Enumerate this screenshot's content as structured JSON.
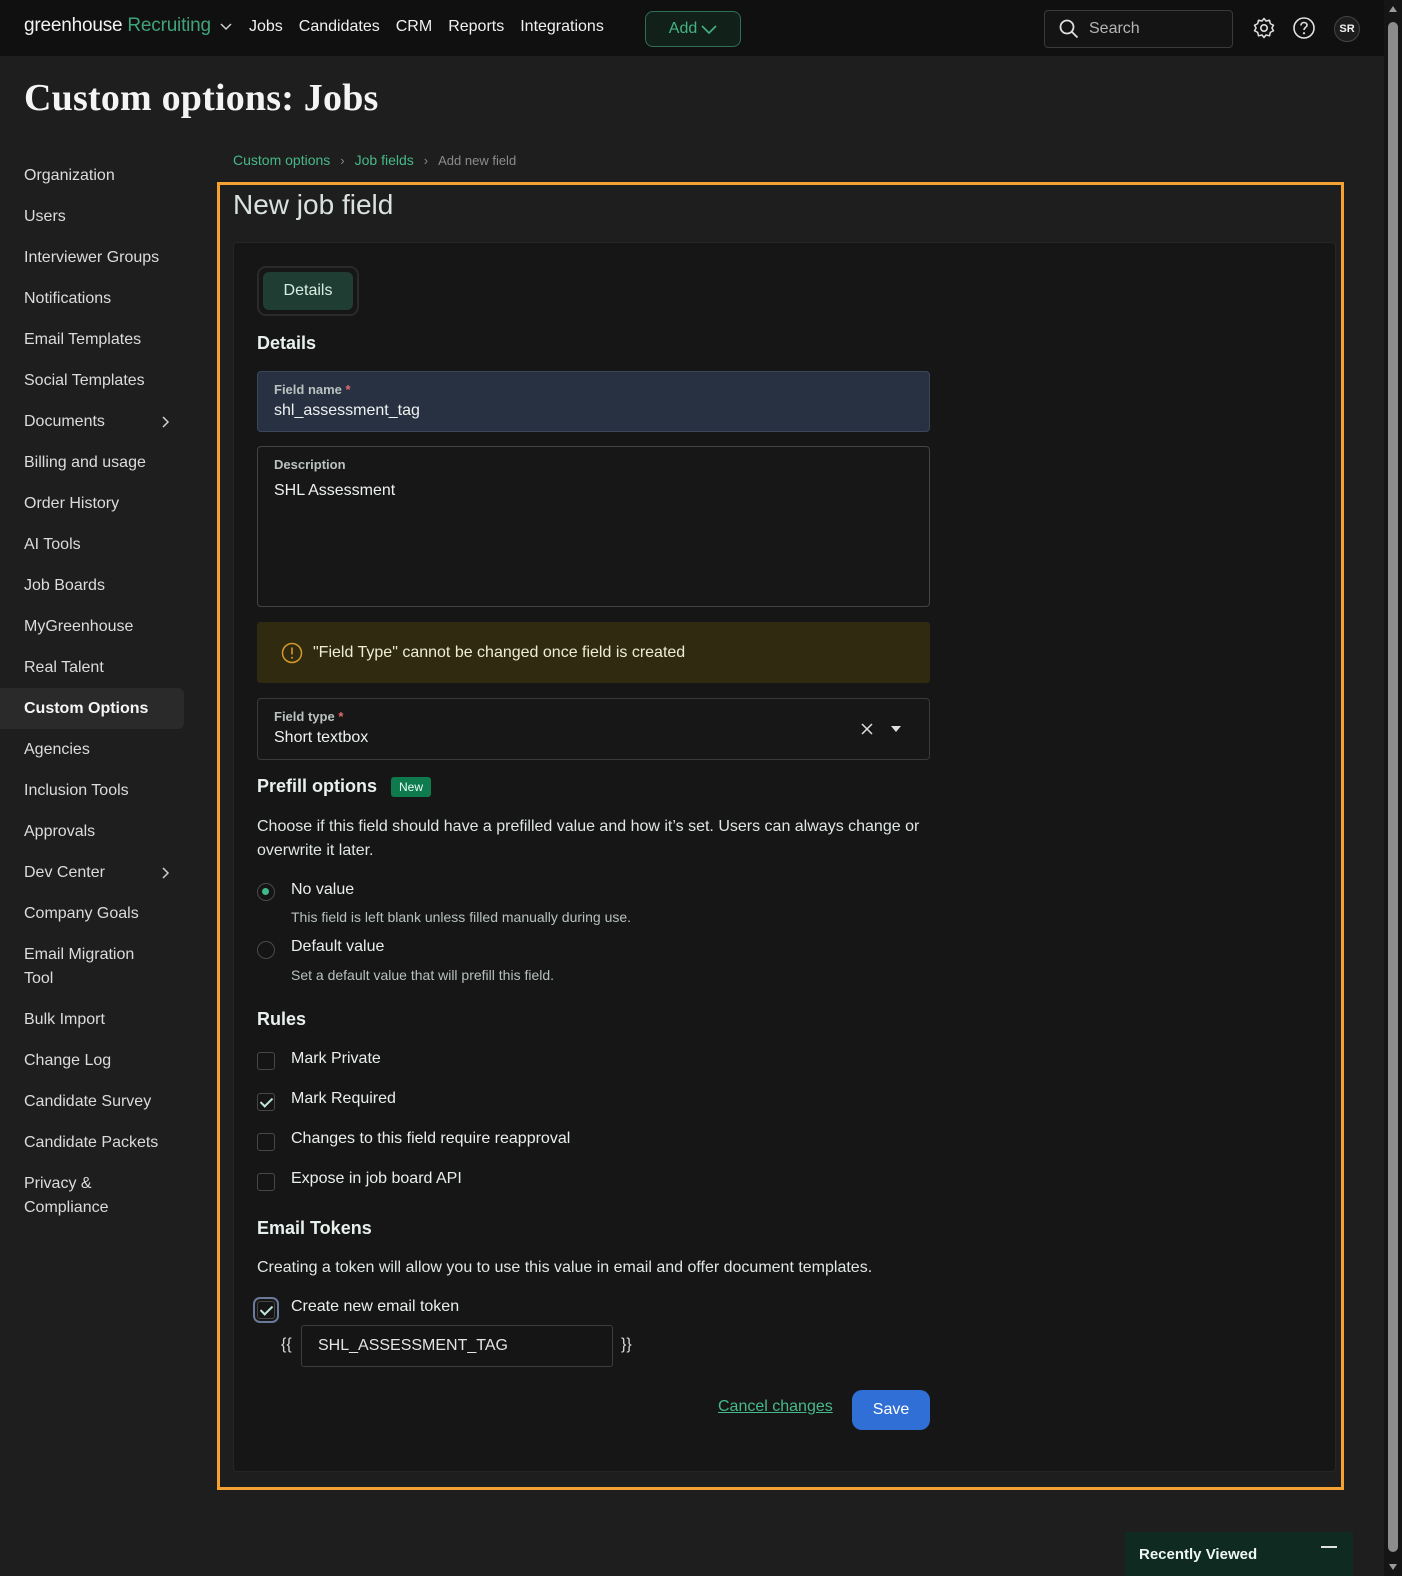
{
  "topnav": {
    "logo_main": "greenhouse",
    "logo_sub": "Recruiting",
    "links": [
      "Jobs",
      "Candidates",
      "CRM",
      "Reports",
      "Integrations"
    ],
    "add_label": "Add",
    "search_placeholder": "Search",
    "avatar_initials": "SR"
  },
  "page_title": "Custom options: Jobs",
  "sidebar": {
    "items": [
      {
        "label": "Organization",
        "has_chevron": false,
        "active": false
      },
      {
        "label": "Users",
        "has_chevron": false,
        "active": false
      },
      {
        "label": "Interviewer Groups",
        "has_chevron": false,
        "active": false
      },
      {
        "label": "Notifications",
        "has_chevron": false,
        "active": false
      },
      {
        "label": "Email Templates",
        "has_chevron": false,
        "active": false
      },
      {
        "label": "Social Templates",
        "has_chevron": false,
        "active": false
      },
      {
        "label": "Documents",
        "has_chevron": true,
        "active": false
      },
      {
        "label": "Billing and usage",
        "has_chevron": false,
        "active": false
      },
      {
        "label": "Order History",
        "has_chevron": false,
        "active": false
      },
      {
        "label": "AI Tools",
        "has_chevron": false,
        "active": false
      },
      {
        "label": "Job Boards",
        "has_chevron": false,
        "active": false
      },
      {
        "label": "MyGreenhouse",
        "has_chevron": false,
        "active": false
      },
      {
        "label": "Real Talent",
        "has_chevron": false,
        "active": false
      },
      {
        "label": "Custom Options",
        "has_chevron": false,
        "active": true
      },
      {
        "label": "Agencies",
        "has_chevron": false,
        "active": false
      },
      {
        "label": "Inclusion Tools",
        "has_chevron": false,
        "active": false
      },
      {
        "label": "Approvals",
        "has_chevron": false,
        "active": false
      },
      {
        "label": "Dev Center",
        "has_chevron": true,
        "active": false
      },
      {
        "label": "Company Goals",
        "has_chevron": false,
        "active": false
      },
      {
        "label": "Email Migration Tool",
        "has_chevron": false,
        "active": false
      },
      {
        "label": "Bulk Import",
        "has_chevron": false,
        "active": false
      },
      {
        "label": "Change Log",
        "has_chevron": false,
        "active": false
      },
      {
        "label": "Candidate Survey",
        "has_chevron": false,
        "active": false
      },
      {
        "label": "Candidate Packets",
        "has_chevron": false,
        "active": false
      },
      {
        "label": "Privacy & Compliance",
        "has_chevron": false,
        "active": false
      }
    ]
  },
  "breadcrumb": {
    "items": [
      "Custom options",
      "Job fields"
    ],
    "current": "Add new field"
  },
  "form": {
    "title": "New job field",
    "tab_label": "Details",
    "details_heading": "Details",
    "field_name": {
      "label": "Field name",
      "required_mark": "*",
      "value": "shl_assessment_tag"
    },
    "description": {
      "label": "Description",
      "value": "SHL Assessment"
    },
    "alert_text": "\"Field Type\" cannot be changed once field is created",
    "field_type": {
      "label": "Field type",
      "required_mark": "*",
      "value": "Short textbox"
    },
    "prefill": {
      "heading": "Prefill options",
      "badge": "New",
      "description": "Choose if this field should have a prefilled value and how it’s set. Users can always change or overwrite it later.",
      "options": [
        {
          "label": "No value",
          "help": "This field is left blank unless filled manually during use.",
          "selected": true
        },
        {
          "label": "Default value",
          "help": "Set a default value that will prefill this field.",
          "selected": false
        }
      ]
    },
    "rules": {
      "heading": "Rules",
      "items": [
        {
          "label": "Mark Private",
          "checked": false
        },
        {
          "label": "Mark Required",
          "checked": true
        },
        {
          "label": "Changes to this field require reapproval",
          "checked": false
        },
        {
          "label": "Expose in job board API",
          "checked": false
        }
      ]
    },
    "email_tokens": {
      "heading": "Email Tokens",
      "description": "Creating a token will allow you to use this value in email and offer document templates.",
      "checkbox_label": "Create new email token",
      "checked": true,
      "open_brace": "{{",
      "close_brace": "}}",
      "token_value": "SHL_ASSESSMENT_TAG"
    },
    "cancel_label": "Cancel changes",
    "save_label": "Save"
  },
  "recently_viewed": {
    "label": "Recently Viewed"
  },
  "colors": {
    "accent": "#3fa37a",
    "highlight": "#f5a232",
    "save": "#2f6fd6",
    "alert_bg": "#2f2a10"
  }
}
